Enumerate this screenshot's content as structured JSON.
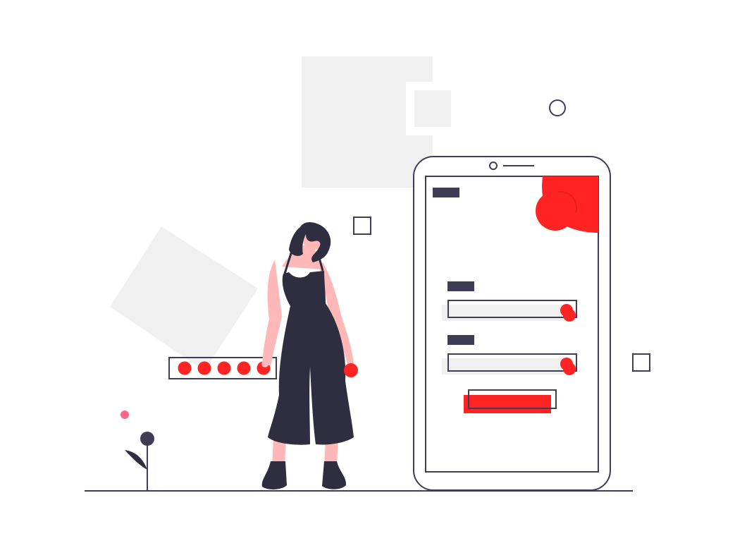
{
  "illustration": {
    "subject": "person-beside-phone-login-form",
    "colors": {
      "background": "#ffffff",
      "panel_grey": "#f0f0f0",
      "outline": "#3f3d56",
      "accent_red": "#ff2323",
      "skin": "#ffb8b8",
      "outfit_dark": "#2f2e41",
      "flower_pink": "#ff6584"
    },
    "password_dots": 5,
    "form_fields": 2,
    "icons": [
      "phone-device-icon",
      "person-figure-icon",
      "flower-plant-icon"
    ]
  }
}
